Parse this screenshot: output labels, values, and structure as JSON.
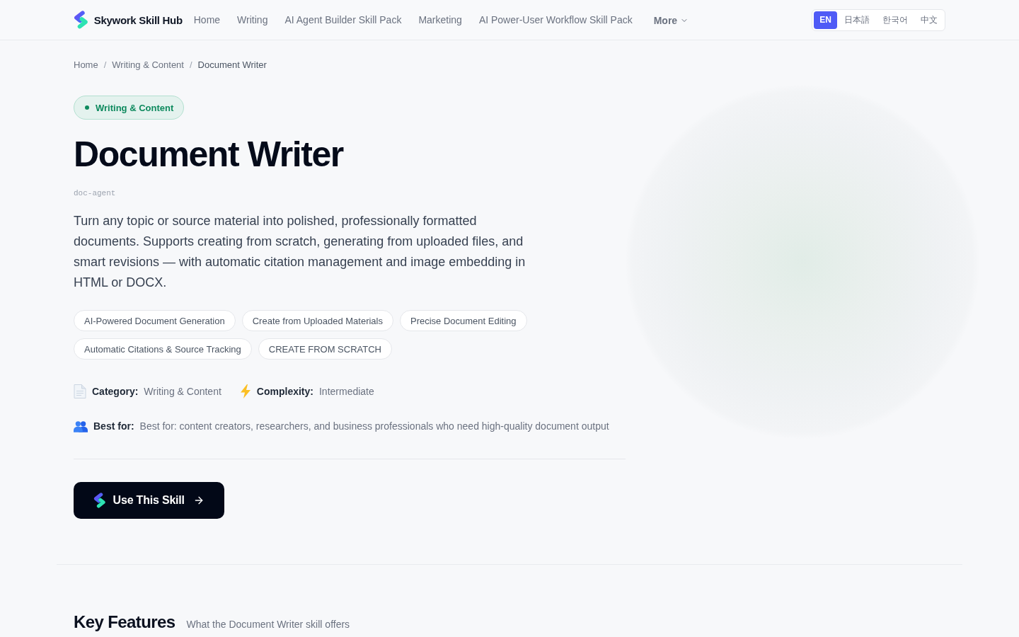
{
  "header": {
    "brand": "Skywork Skill Hub",
    "nav": [
      "Home",
      "Writing",
      "AI Agent Builder Skill Pack",
      "Marketing",
      "AI Power-User Workflow Skill Pack"
    ],
    "more": "More",
    "languages": [
      {
        "label": "EN",
        "selected": true
      },
      {
        "label": "日本語",
        "selected": false
      },
      {
        "label": "한국어",
        "selected": false
      },
      {
        "label": "中文",
        "selected": false
      }
    ]
  },
  "breadcrumb": {
    "separator": "/",
    "items": [
      "Home",
      "Writing & Content",
      "Document Writer"
    ]
  },
  "hero": {
    "badge": "Writing & Content",
    "title": "Document Writer",
    "slug": "doc-agent",
    "description": "Turn any topic or source material into polished, professionally formatted documents. Supports creating from scratch, generating from uploaded files, and smart revisions — with automatic citation management and image embedding in HTML or DOCX.",
    "tags": [
      "AI-Powered Document Generation",
      "Create from Uploaded Materials",
      "Precise Document Editing",
      "Automatic Citations & Source Tracking",
      "CREATE FROM SCRATCH"
    ],
    "meta_rows": [
      [
        {
          "kind": "document",
          "label": "Category:",
          "value": "Writing & Content"
        },
        {
          "kind": "lightning",
          "label": "Complexity:",
          "value": "Intermediate"
        }
      ],
      [
        {
          "kind": "people",
          "label": "Best for:",
          "value": "Best for: content creators, researchers, and business professionals who need high-quality document output"
        }
      ]
    ],
    "cta": "Use This Skill"
  },
  "key_features": {
    "title": "Key Features",
    "subtitle": "What the Document Writer skill offers"
  }
}
